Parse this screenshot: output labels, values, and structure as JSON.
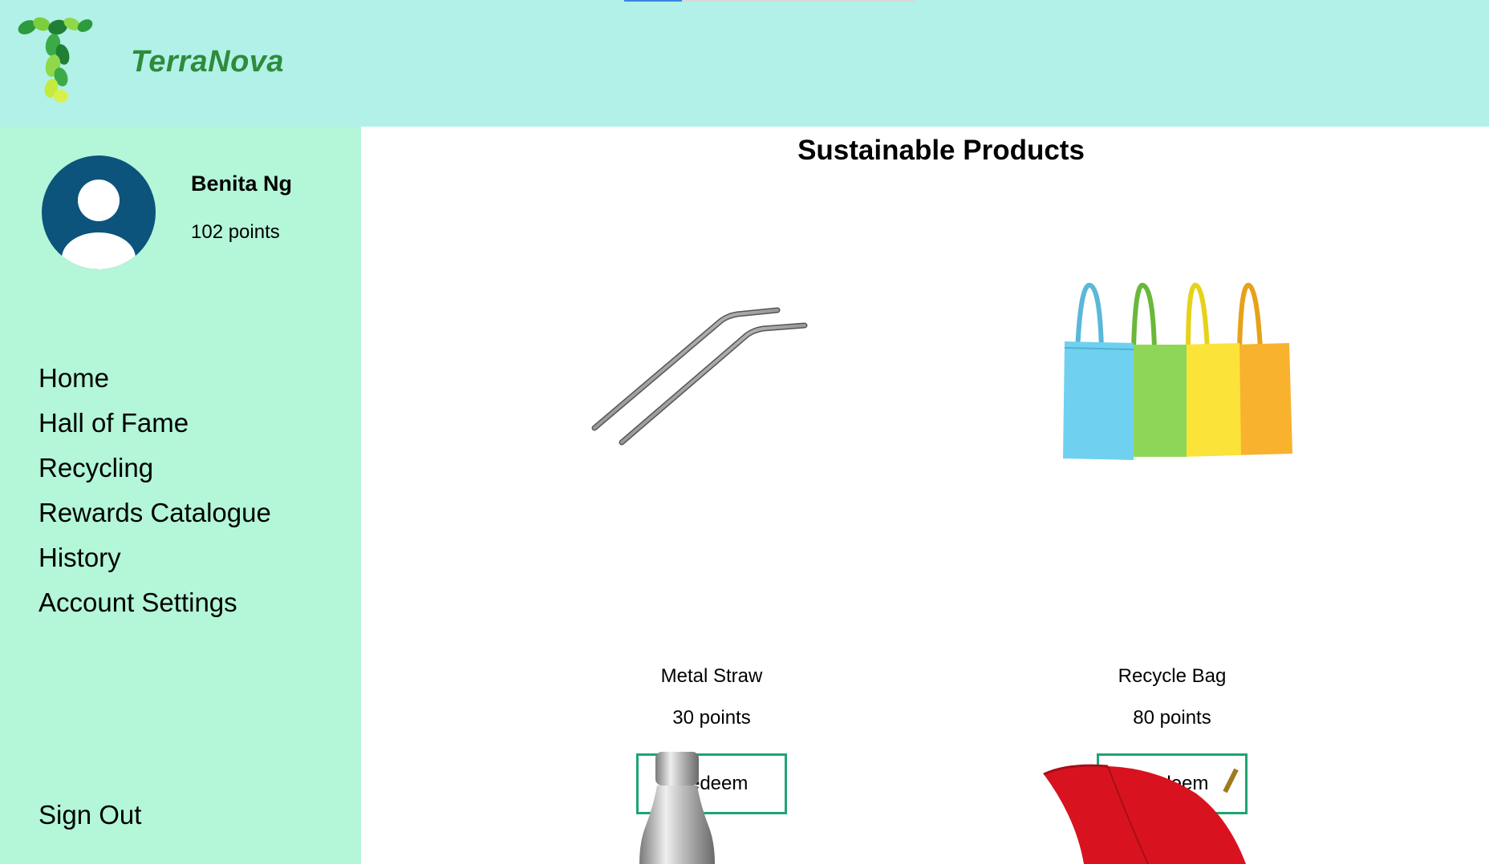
{
  "brand": {
    "name": "TerraNova",
    "logo_icon": "leaf-letter-t-logo",
    "color": "#2e8b3b"
  },
  "colors": {
    "header_bg": "#b1f1e8",
    "sidebar_bg": "#b3f6d8",
    "button_border": "#1ea472",
    "avatar": "#0c547c"
  },
  "user": {
    "name": "Benita Ng",
    "points": "102 points",
    "avatar_icon": "user-avatar-icon"
  },
  "nav": {
    "items": [
      {
        "label": "Home"
      },
      {
        "label": "Hall of Fame"
      },
      {
        "label": "Recycling"
      },
      {
        "label": "Rewards Catalogue"
      },
      {
        "label": "History"
      },
      {
        "label": "Account Settings"
      }
    ],
    "signout": "Sign Out"
  },
  "main": {
    "title": "Sustainable Products",
    "products": [
      {
        "name": "Metal Straw",
        "points": "30 points",
        "button": "Redeem",
        "image": "metal-straw-image"
      },
      {
        "name": "Recycle Bag",
        "points": "80 points",
        "button": "Redeem",
        "image": "recycle-bag-image"
      },
      {
        "image": "water-bottle-image"
      },
      {
        "image": "umbrella-image"
      }
    ]
  }
}
